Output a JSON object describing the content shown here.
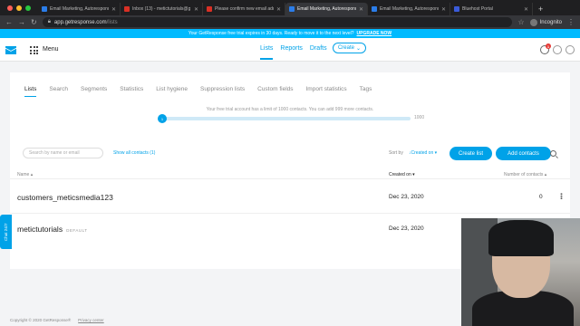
{
  "browser": {
    "tabs": [
      {
        "title": "Email Marketing, Autorespond",
        "color": "#2b7de9",
        "active": false
      },
      {
        "title": "Inbox (13) - metictutorials@g",
        "color": "#d93025",
        "active": false
      },
      {
        "title": "Please confirm new email add",
        "color": "#d93025",
        "active": false
      },
      {
        "title": "Email Marketing, Autorespond",
        "color": "#2b7de9",
        "active": true
      },
      {
        "title": "Email Marketing, Autorespond",
        "color": "#2b7de9",
        "active": false
      },
      {
        "title": "Bluehost Portal",
        "color": "#3a5bd9",
        "active": false
      }
    ],
    "url_host": "app.getresponse.com",
    "url_path": "/lists",
    "profile_label": "Incognito"
  },
  "banner": {
    "text": "Your GetResponse free trial expires in 30 days. Ready to move it to the next level?",
    "link": "UPGRADE NOW"
  },
  "header": {
    "menu_label": "Menu",
    "nav": [
      "Lists",
      "Reports",
      "Drafts"
    ],
    "create_label": "Create",
    "notification_count": "1"
  },
  "subtabs": [
    "Lists",
    "Search",
    "Segments",
    "Statistics",
    "List hygiene",
    "Suppression lists",
    "Custom fields",
    "Import statistics",
    "Tags"
  ],
  "trial_text": "Your free trial account has a limit of 1000 contacts. You can add 999 more contacts.",
  "slider": {
    "knob_label": "1",
    "max_label": "1000",
    "value": 1,
    "max": 1000
  },
  "toolbar": {
    "search_placeholder": "Search by name or email",
    "show_all": "Show all contacts (1)",
    "sort_by": "Sort by",
    "sort_value": "Created on",
    "create_list": "Create list",
    "add_contacts": "Add contacts"
  },
  "columns": {
    "name": "Name",
    "created": "Created on",
    "contacts": "Number of contacts"
  },
  "rows": [
    {
      "name": "customers_meticsmedia123",
      "tag": "",
      "created": "Dec 23, 2020",
      "contacts": "0"
    },
    {
      "name": "metictutorials",
      "tag": "DEFAULT",
      "created": "Dec 23, 2020",
      "contacts": ""
    }
  ],
  "chat_label": "Chat 24/7",
  "footer": {
    "copyright": "Copyright © 2020 GetResponse®",
    "privacy": "Privacy center"
  }
}
